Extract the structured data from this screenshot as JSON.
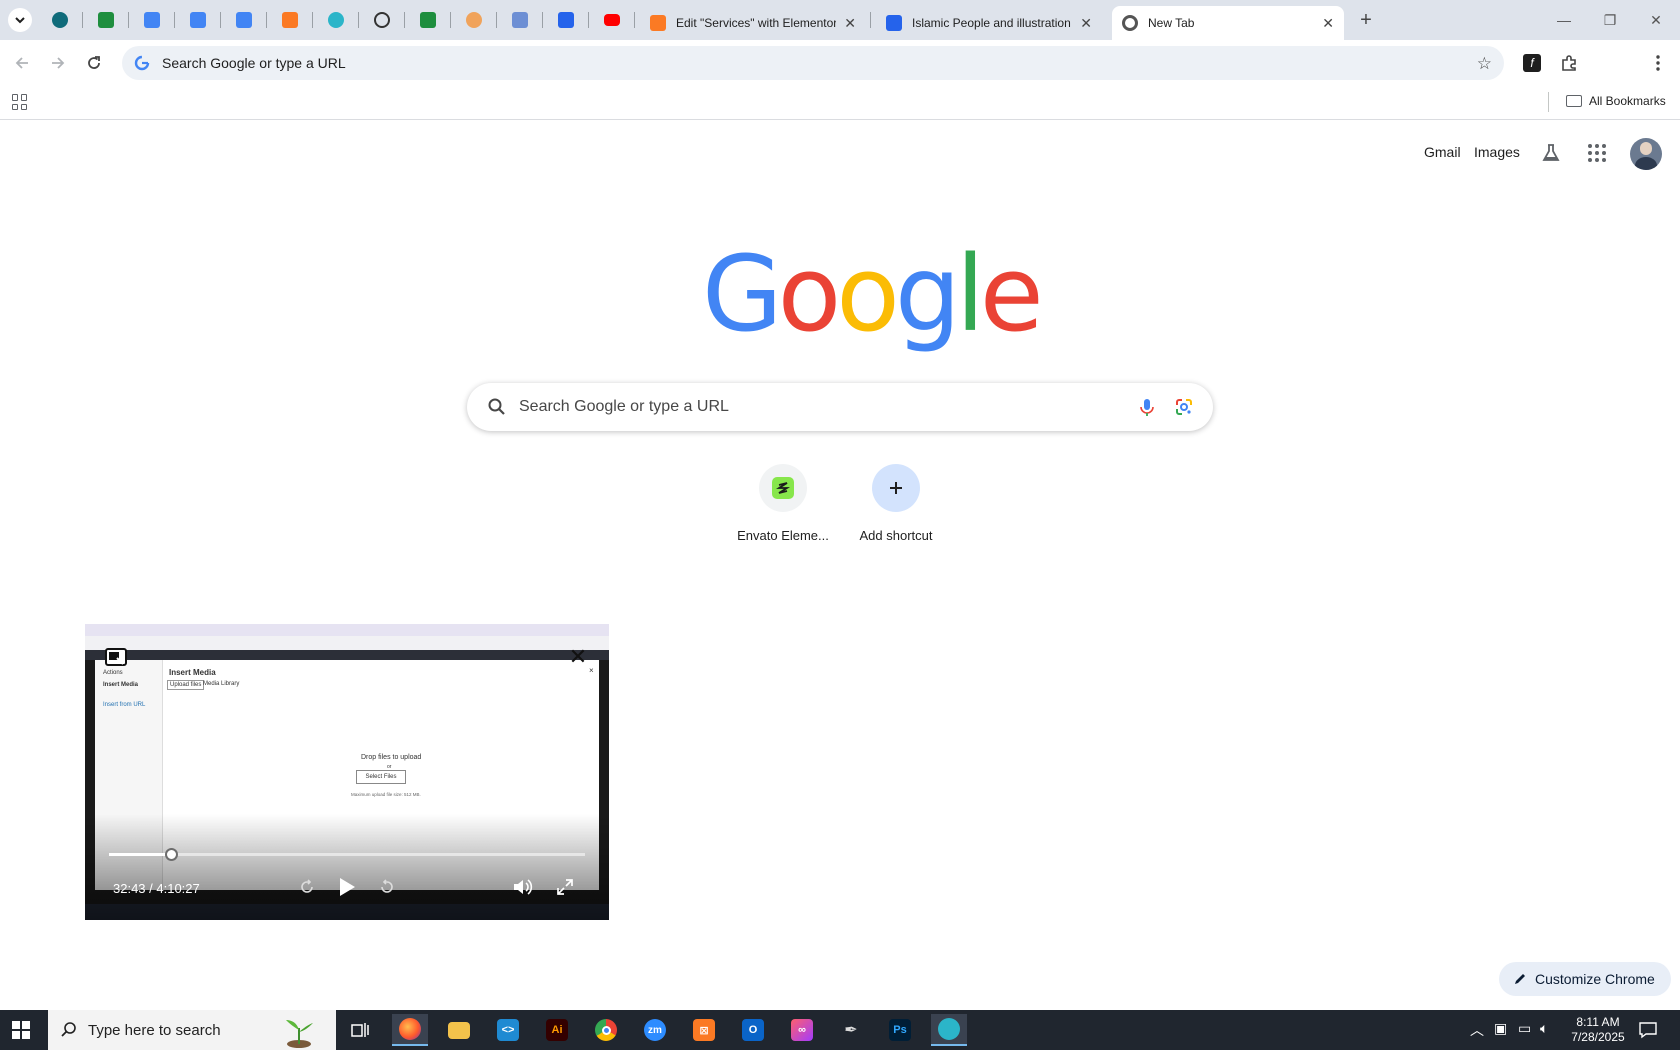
{
  "browser": {
    "tabs": [
      {
        "title": "Edit \"Services\" with Elementor",
        "close": "✕"
      },
      {
        "title": "Islamic People and illustration v",
        "close": "✕"
      },
      {
        "title": "New Tab",
        "close": "✕"
      }
    ],
    "new_tab_label": "+",
    "window_controls": {
      "minimize": "—",
      "restore": "❐",
      "close": "✕"
    },
    "omnibox_text": "Search Google or type a URL",
    "bookmarks_bar": {
      "all_bookmarks": "All Bookmarks"
    }
  },
  "ntp": {
    "header_links": {
      "gmail": "Gmail",
      "images": "Images"
    },
    "logo_letters": [
      "G",
      "o",
      "o",
      "g",
      "l",
      "e"
    ],
    "logo_colors": [
      "#4285f4",
      "#ea4335",
      "#fbbc05",
      "#4285f4",
      "#34a853",
      "#ea4335"
    ],
    "search_placeholder": "Search Google or type a URL",
    "shortcuts": [
      {
        "label": "Envato Eleme..."
      },
      {
        "label": "Add shortcut"
      }
    ],
    "customize_label": "Customize Chrome"
  },
  "video_pip": {
    "time": "32:43 / 4:10:27",
    "progress_fraction": 0.13,
    "inner_screen": {
      "dialog_title": "Insert Media",
      "actions_label": "Actions",
      "side_items": [
        "Insert Media",
        "Insert from URL"
      ],
      "tabs": [
        "Upload files",
        "Media Library"
      ],
      "drop_text": "Drop files to upload",
      "or_text": "or",
      "select_button": "Select Files",
      "max_size": "Maximum upload file size: 512 MB."
    }
  },
  "taskbar": {
    "search_placeholder": "Type here to search",
    "clock_time": "8:11 AM",
    "clock_date": "7/28/2025"
  },
  "colors": {
    "tabstrip": "#dee3eb",
    "omnibox": "#edf1f6",
    "accent_blue": "#0b57d0",
    "taskbar": "#20262f"
  }
}
